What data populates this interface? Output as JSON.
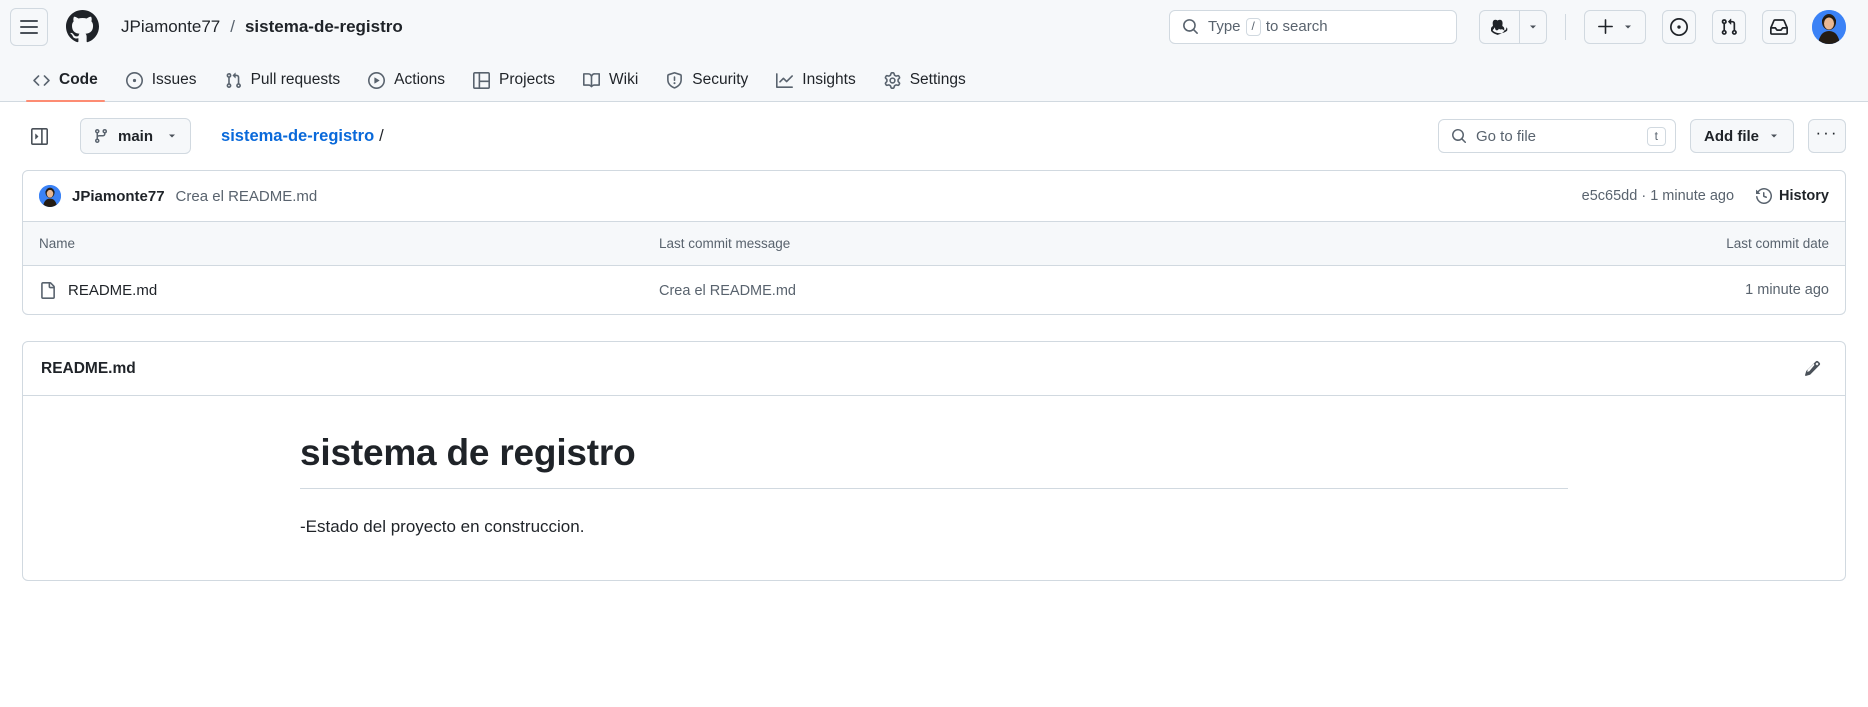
{
  "header": {
    "menu_icon": "hamburger-icon",
    "logo_icon": "github-logo-icon",
    "owner": "JPiamonte77",
    "separator": "/",
    "repo": "sistema-de-registro",
    "search": {
      "placeholder_prefix": "Type",
      "slash_key": "/",
      "placeholder_suffix": "to search",
      "icon": "search-icon"
    },
    "copilot_icon": "copilot-icon",
    "copilot_caret_icon": "chevron-down-icon",
    "plus_icon": "plus-icon",
    "plus_caret_icon": "chevron-down-icon",
    "issues_icon": "issue-opened-icon",
    "pull_requests_icon": "git-pull-request-icon",
    "inbox_icon": "inbox-icon",
    "avatar": "user-avatar"
  },
  "repo_nav": {
    "items": [
      {
        "label": "Code",
        "icon": "code-icon",
        "active": true
      },
      {
        "label": "Issues",
        "icon": "issue-opened-icon",
        "active": false
      },
      {
        "label": "Pull requests",
        "icon": "git-pull-request-icon",
        "active": false
      },
      {
        "label": "Actions",
        "icon": "play-icon",
        "active": false
      },
      {
        "label": "Projects",
        "icon": "table-icon",
        "active": false
      },
      {
        "label": "Wiki",
        "icon": "book-icon",
        "active": false
      },
      {
        "label": "Security",
        "icon": "shield-icon",
        "active": false
      },
      {
        "label": "Insights",
        "icon": "graph-icon",
        "active": false
      },
      {
        "label": "Settings",
        "icon": "gear-icon",
        "active": false
      }
    ],
    "active_underline_color": "#fd8c73"
  },
  "file_bar": {
    "sidebar_toggle_icon": "sidebar-expand-icon",
    "branch": {
      "icon": "git-branch-icon",
      "name": "main",
      "caret_icon": "chevron-down-icon"
    },
    "breadcrumb": {
      "repo": "sistema-de-registro",
      "trailing_slash": "/"
    },
    "go_to_file": {
      "icon": "search-icon",
      "placeholder": "Go to file",
      "shortcut_key": "t"
    },
    "add_file": {
      "label": "Add file",
      "caret_icon": "chevron-down-icon"
    },
    "kebab": {
      "label": "···",
      "icon": "kebab-horizontal-icon"
    }
  },
  "latest_commit": {
    "avatar": "author-avatar",
    "author": "JPiamonte77",
    "message": "Crea el README.md",
    "sha": "e5c65dd",
    "separator": "·",
    "relative_time": "1 minute ago",
    "history": {
      "icon": "history-icon",
      "label": "History"
    }
  },
  "file_table": {
    "columns": {
      "name": "Name",
      "message": "Last commit message",
      "date": "Last commit date"
    },
    "rows": [
      {
        "icon": "file-icon",
        "name": "README.md",
        "message": "Crea el README.md",
        "date": "1 minute ago"
      }
    ]
  },
  "readme": {
    "title": "README.md",
    "edit_icon": "pencil-icon",
    "heading": "sistema de registro",
    "paragraph": "-Estado del proyecto en construccion."
  },
  "colors": {
    "accent": "#0969da",
    "active_tab_underline": "#fd8c73",
    "border": "#d1d9e0",
    "canvas_subtle": "#f6f8fa",
    "fg_muted": "#59636e",
    "fg_default": "#1f2328"
  }
}
